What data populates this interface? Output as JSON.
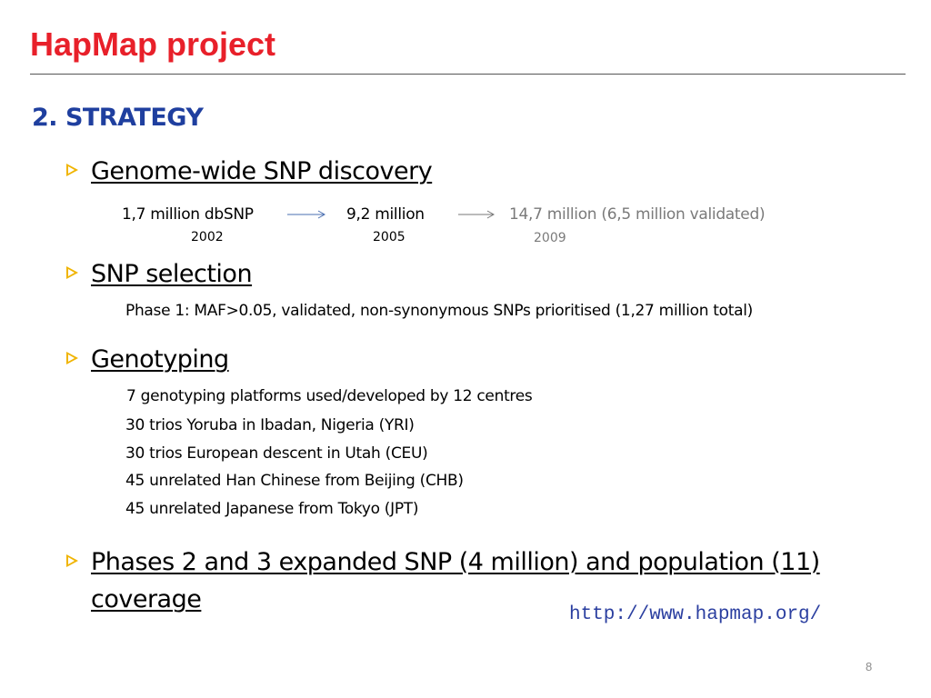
{
  "slide": {
    "title": "HapMap project",
    "section": "2. STRATEGY",
    "page_number": "8",
    "url": "http://www.hapmap.org/"
  },
  "bullets": [
    {
      "label": "Genome-wide SNP discovery",
      "timeline": [
        {
          "value": "1,7 million dbSNP",
          "year": "2002"
        },
        {
          "value": "9,2 million",
          "year": "2005"
        },
        {
          "value": "14,7 million (6,5 million validated)",
          "year": "2009"
        }
      ]
    },
    {
      "label": "SNP selection",
      "detail": "Phase 1: MAF>0.05, validated, non-synonymous SNPs prioritised (1,27 million total)"
    },
    {
      "label": "Genotyping",
      "detail": "7 genotyping platforms used/developed by 12 centres",
      "populations": [
        "30 trios Yoruba in Ibadan, Nigeria (YRI)",
        "30 trios European descent in Utah (CEU)",
        "45 unrelated Han Chinese from Beijing (CHB)",
        "45 unrelated Japanese from Tokyo (JPT)"
      ]
    },
    {
      "label_line1": "Phases 2 and 3 expanded SNP (4 million) and population (11)",
      "label_line2": "coverage"
    }
  ],
  "colors": {
    "title": "#e8202a",
    "section": "#1f3f9f",
    "bullet_marker": "#f0b400",
    "url": "#2b3fa0",
    "arrow": "#4a6fb0"
  }
}
